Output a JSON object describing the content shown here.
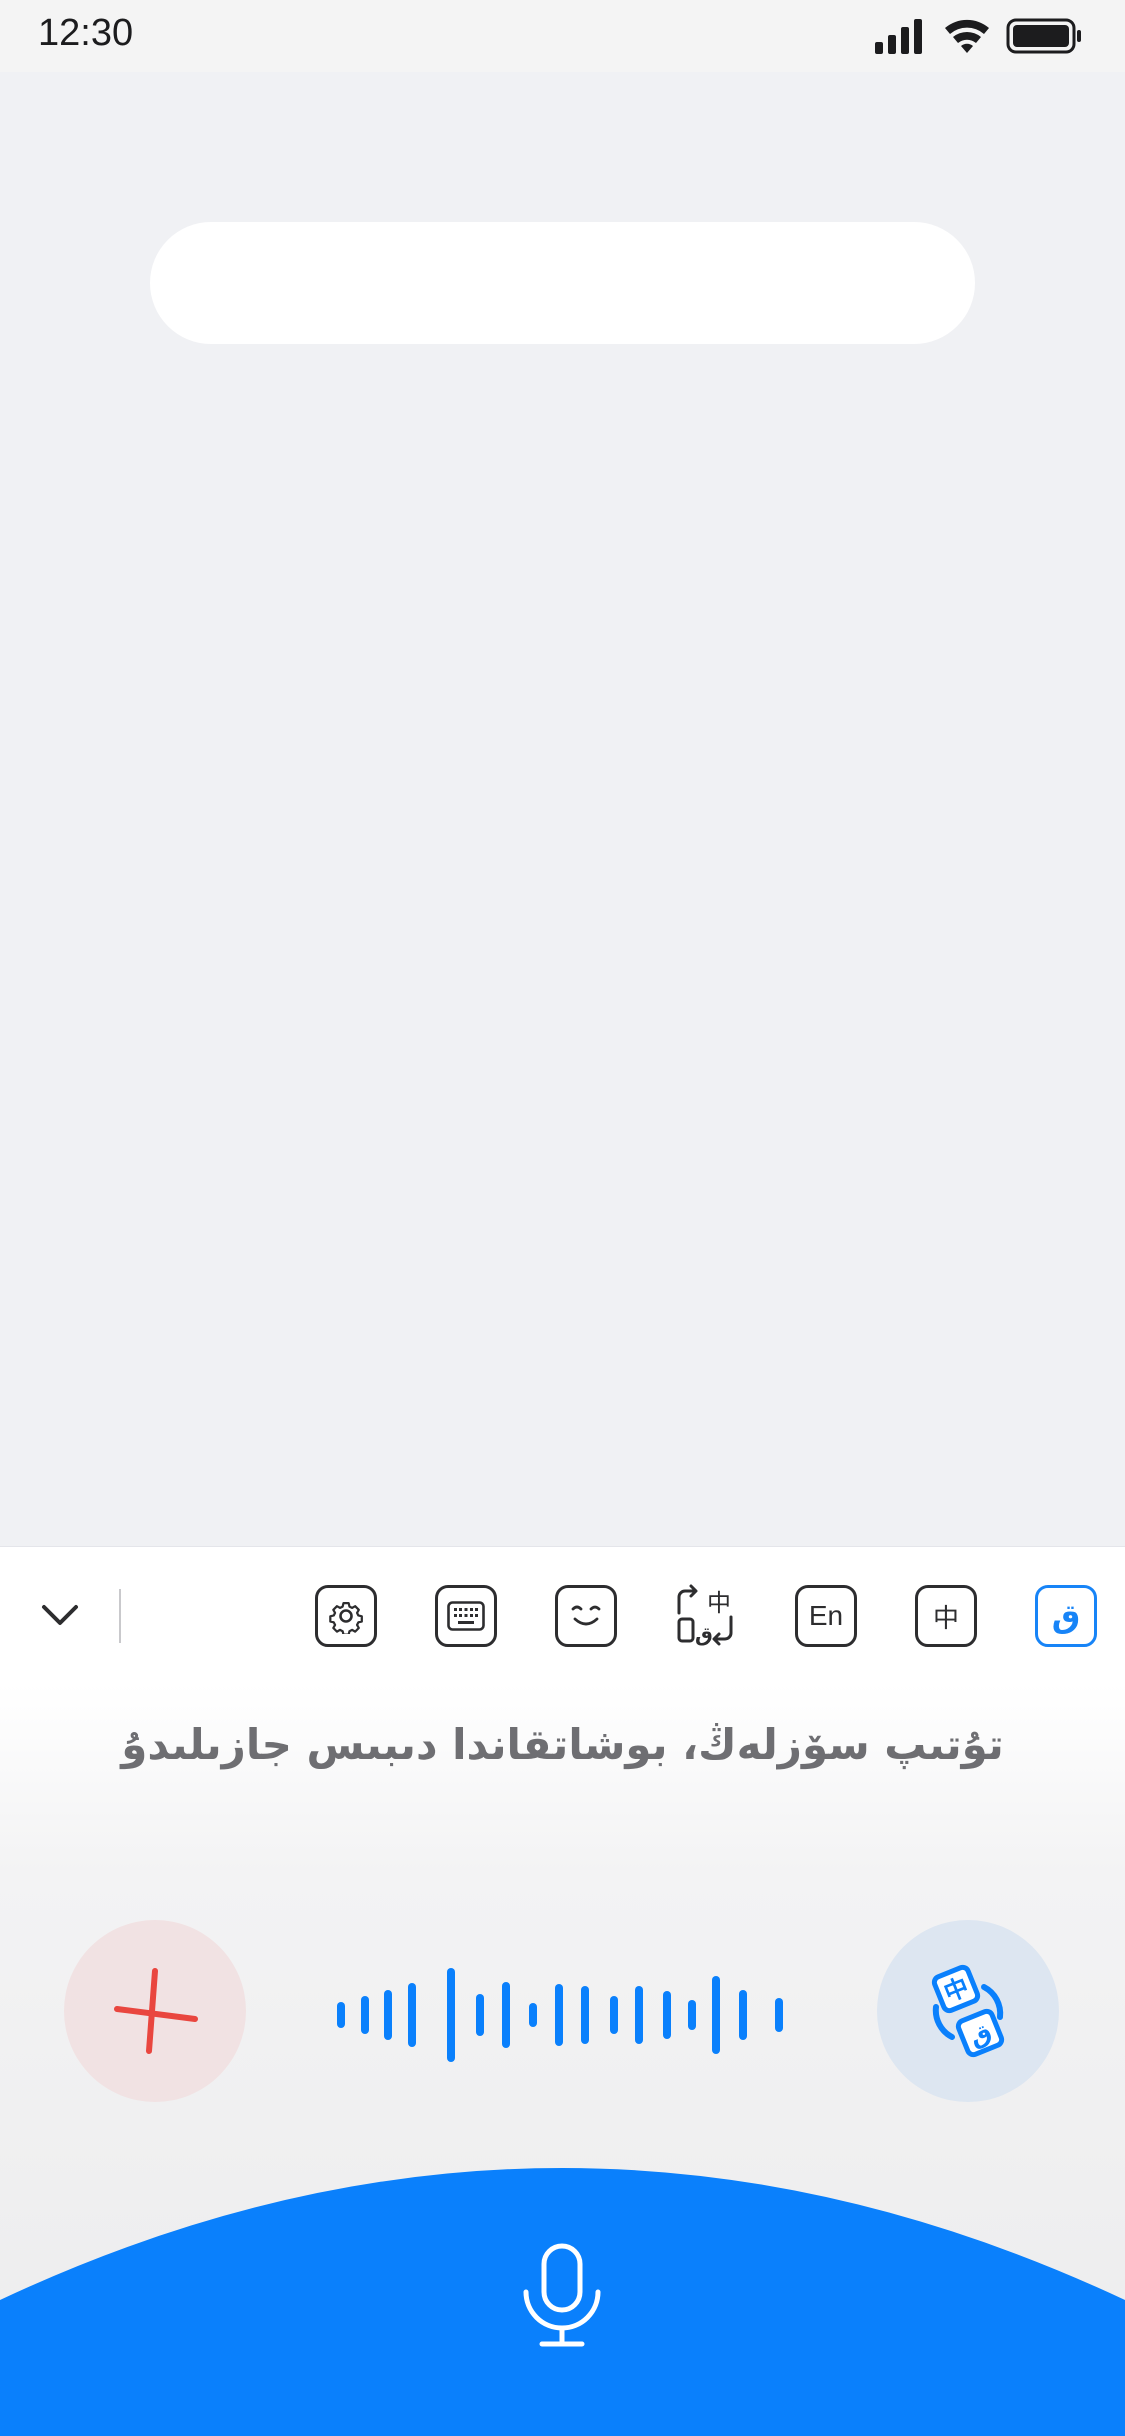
{
  "status_bar": {
    "time": "12:30"
  },
  "text_field": {
    "value": ""
  },
  "toolbar": {
    "buttons": [
      {
        "name": "uyghur-layout",
        "label": "ق",
        "active": true
      },
      {
        "name": "chinese-layout",
        "label": "中",
        "active": false
      },
      {
        "name": "english-layout",
        "label": "En",
        "active": false
      },
      {
        "name": "translate-layout",
        "icon": "translate-swap-icon",
        "active": false
      },
      {
        "name": "emoji",
        "icon": "emoji-icon",
        "active": false
      },
      {
        "name": "keyboard",
        "icon": "keyboard-icon",
        "active": false
      },
      {
        "name": "settings",
        "icon": "gear-icon",
        "active": false
      }
    ]
  },
  "voice": {
    "hint": "تۇتىپ سۆزلەڭ، بوشاتقاندا دىبىس جازىلىدۇ"
  },
  "colors": {
    "accent": "#0a80fc",
    "cancel": "#e9463f",
    "cancel_bg": "#f1e2e3",
    "translate_bg": "#dde6f1",
    "background": "#f0f1f4"
  }
}
